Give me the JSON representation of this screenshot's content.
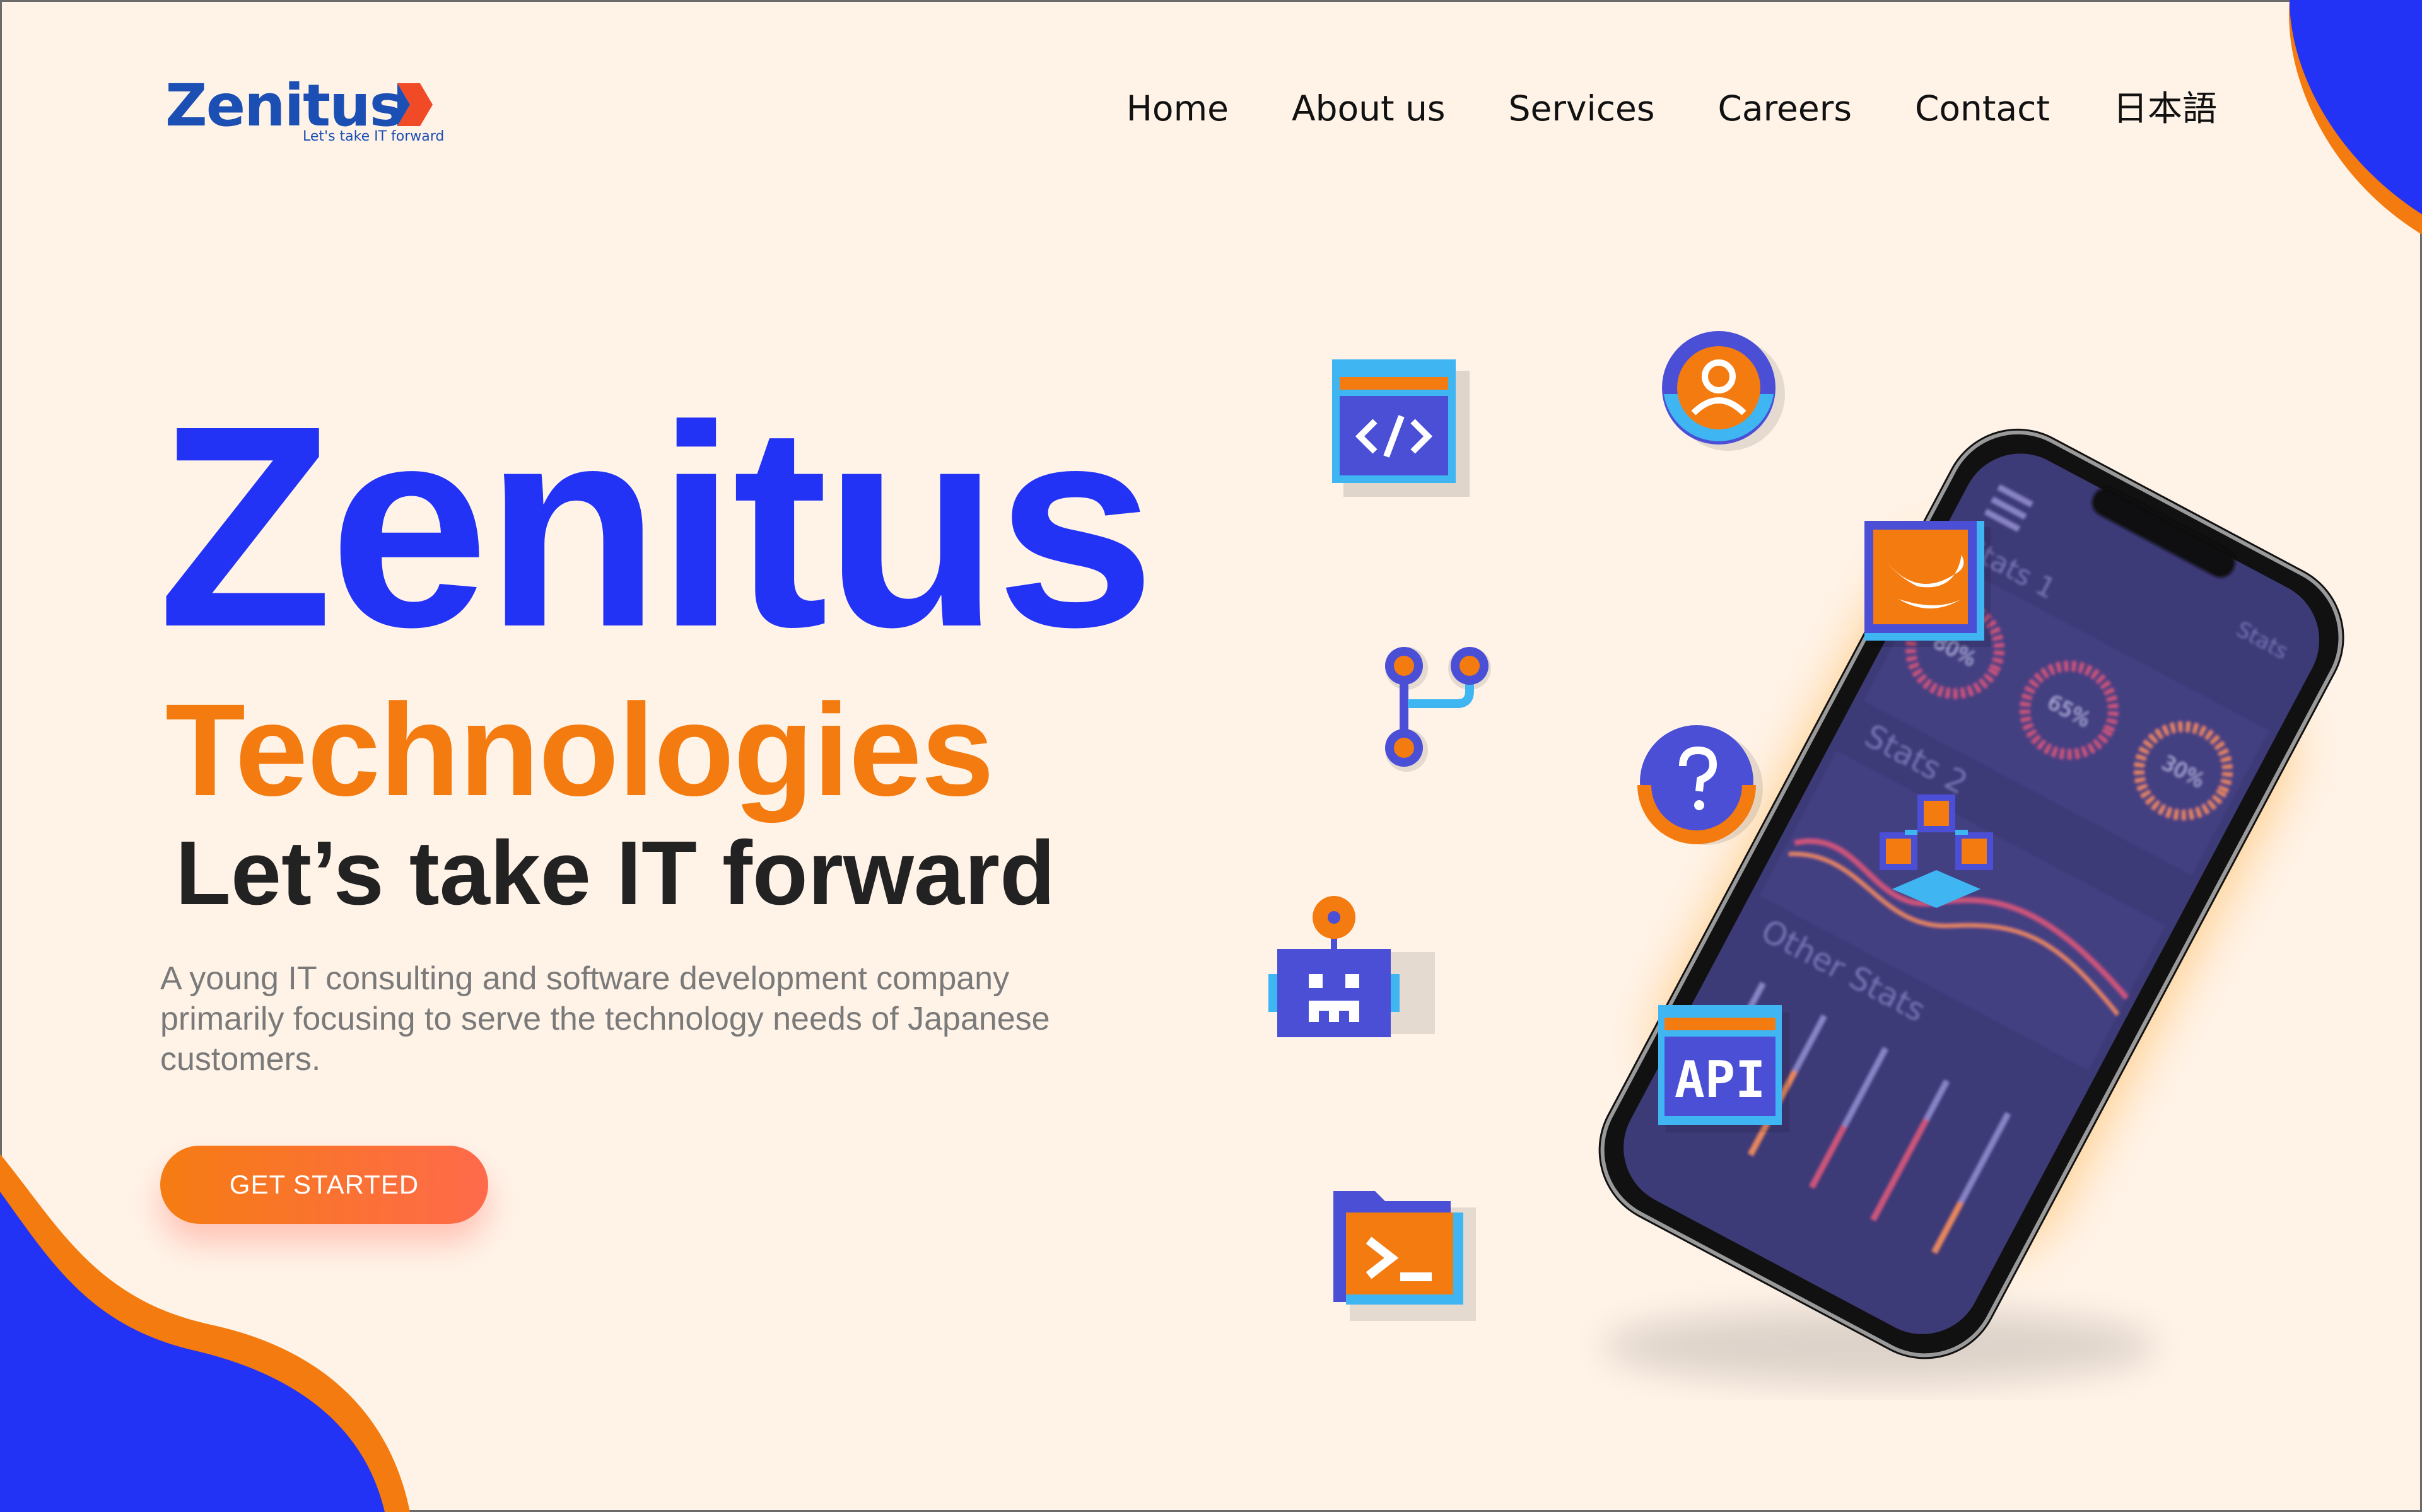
{
  "brand": {
    "name": "Zenitus",
    "tagline": "Let's take IT forward"
  },
  "nav": {
    "items": [
      "Home",
      "About us",
      "Services",
      "Careers",
      "Contact",
      "日本語"
    ]
  },
  "hero": {
    "title": "Zenitus",
    "subtitle": "Technologies",
    "tagline": "Let’s take IT forward",
    "description": "A young IT consulting and software development company primarily focusing to serve the technology needs of Japanese customers.",
    "cta": "GET STARTED"
  },
  "phone_screen": {
    "stats_percent": [
      "80%",
      "65%",
      "30%"
    ],
    "header_label": "Stats",
    "section_1": "Stats 1",
    "section_2": "Stats 2",
    "section_3": "Other Stats"
  },
  "icons": {
    "api_label": "API",
    "names": [
      "code-window-icon",
      "user-profile-icon",
      "git-branch-icon",
      "swift-icon",
      "help-icon",
      "blockchain-cubes-icon",
      "robot-icon",
      "api-icon",
      "terminal-folder-icon"
    ]
  },
  "colors": {
    "background": "#fff3e8",
    "primary_blue": "#2333f5",
    "accent_orange": "#f47b0f",
    "logo_blue": "#1b4fb3",
    "cta_gradient_start": "#f57c12",
    "cta_gradient_end": "#ff6a4c",
    "icon_indigo": "#4a4fd6",
    "icon_sky": "#3fb6f2"
  }
}
